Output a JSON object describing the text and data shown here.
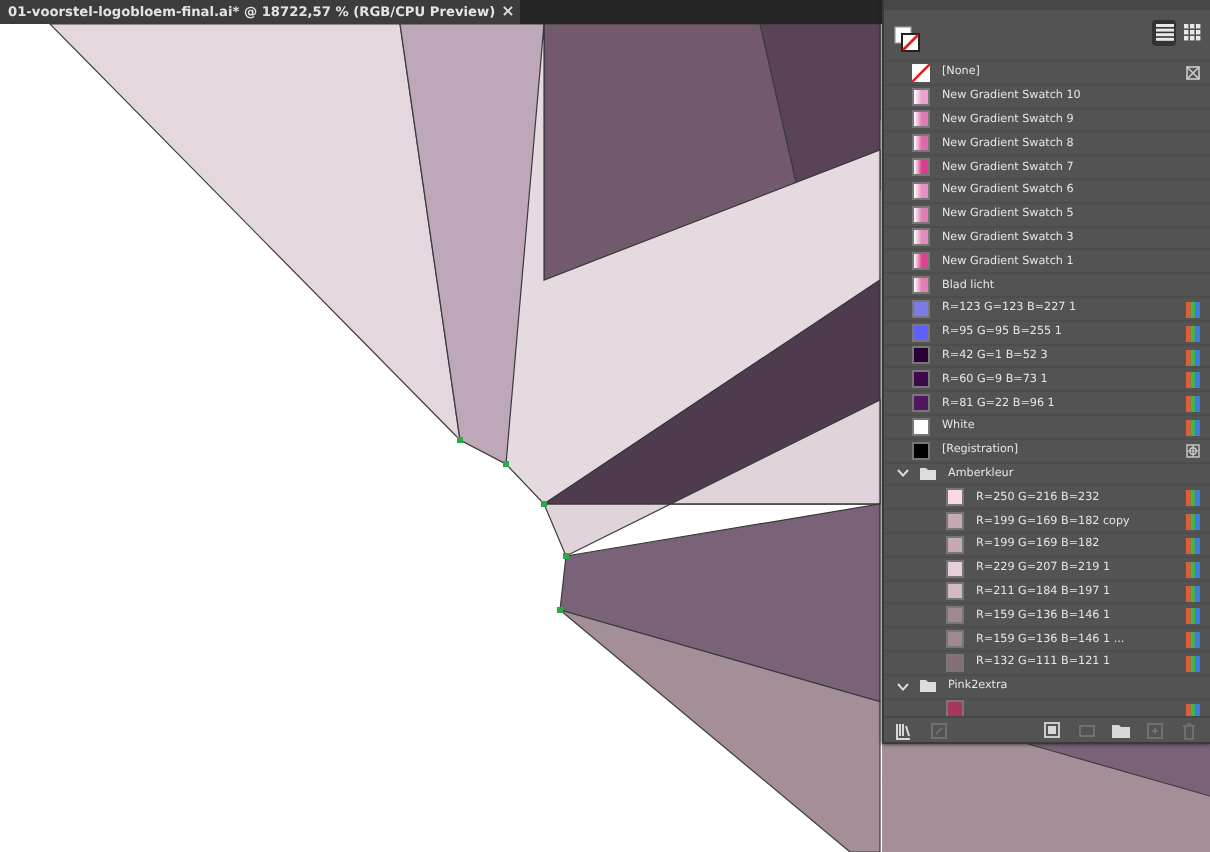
{
  "document_tab": {
    "title": "01-voorstel-logobloem-final.ai* @ 18722,57 % (RGB/CPU Preview)",
    "close": "×",
    "selected": true
  },
  "swatches_panel": {
    "view_buttons": [
      {
        "kind": "list",
        "selected": true
      },
      {
        "kind": "grid",
        "selected": false
      }
    ],
    "rows": [
      {
        "kind": "none",
        "name": "[None]"
      },
      {
        "kind": "gradient",
        "name": "New Gradient Swatch 10",
        "color": "#e9a3cc"
      },
      {
        "kind": "gradient",
        "name": "New Gradient Swatch 9",
        "color": "#e07ab5"
      },
      {
        "kind": "gradient",
        "name": "New Gradient Swatch 8",
        "color": "#dc6aa9"
      },
      {
        "kind": "gradient",
        "name": "New Gradient Swatch 7",
        "color": "#d8408f"
      },
      {
        "kind": "gradient",
        "name": "New Gradient Swatch 6",
        "color": "#e58fc0"
      },
      {
        "kind": "gradient",
        "name": "New Gradient Swatch 5",
        "color": "#df7eb5"
      },
      {
        "kind": "gradient",
        "name": "New Gradient Swatch 3",
        "color": "#e28cbd"
      },
      {
        "kind": "gradient",
        "name": "New Gradient Swatch 1",
        "color": "#d9468f"
      },
      {
        "kind": "gradient",
        "name": "Blad licht",
        "color": "#e27db6"
      },
      {
        "kind": "process",
        "name": "R=123 G=123 B=227 1",
        "color": "#7b7be3"
      },
      {
        "kind": "process",
        "name": "R=95 G=95 B=255 1",
        "color": "#5f5fff"
      },
      {
        "kind": "process",
        "name": "R=42 G=1 B=52 3",
        "color": "#2a0134"
      },
      {
        "kind": "process",
        "name": "R=60 G=9 B=73 1",
        "color": "#3c0949"
      },
      {
        "kind": "process",
        "name": "R=81 G=22 B=96 1",
        "color": "#511660"
      },
      {
        "kind": "process",
        "name": "White",
        "color": "#ffffff"
      },
      {
        "kind": "registration",
        "name": "[Registration]",
        "color": "#000000"
      },
      {
        "kind": "group",
        "name": "Amberkleur",
        "expanded": true,
        "children": [
          {
            "kind": "process",
            "name": "R=250 G=216 B=232",
            "color": "#fad8e8"
          },
          {
            "kind": "process",
            "name": "R=199 G=169 B=182 copy",
            "color": "#c7a9b6"
          },
          {
            "kind": "process",
            "name": "R=199 G=169 B=182",
            "color": "#c7a9b6"
          },
          {
            "kind": "process",
            "name": "R=229 G=207 B=219 1",
            "color": "#e5cfdb"
          },
          {
            "kind": "process",
            "name": "R=211 G=184 B=197 1",
            "color": "#d3b8c5"
          },
          {
            "kind": "process",
            "name": "R=159 G=136 B=146 1",
            "color": "#9f8892"
          },
          {
            "kind": "process",
            "name": "R=159 G=136 B=146 1 ...",
            "color": "#9f8892"
          },
          {
            "kind": "process",
            "name": "R=132 G=111 B=121 1",
            "color": "#846f79"
          }
        ]
      },
      {
        "kind": "group",
        "name": "Pink2extra",
        "expanded": true,
        "children": [
          {
            "kind": "process",
            "color": "#a9365f"
          }
        ]
      }
    ]
  }
}
